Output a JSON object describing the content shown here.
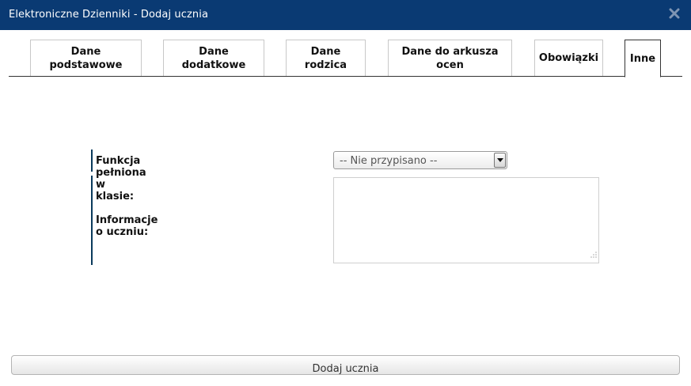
{
  "window": {
    "title": "Elektroniczne Dzienniki - Dodaj ucznia",
    "close_icon": "close-icon"
  },
  "tabs": [
    {
      "label": "Dane\npodstawowe",
      "active": false
    },
    {
      "label": "Dane\ndodatkowe",
      "active": false
    },
    {
      "label": "Dane\nrodzica",
      "active": false
    },
    {
      "label": "Dane do arkusza\nocen",
      "active": false
    },
    {
      "label": "Obowiązki",
      "active": false
    },
    {
      "label": "Inne",
      "active": true
    }
  ],
  "form": {
    "function_label": "Funkcja pełniona w klasie:",
    "function_value": "-- Nie przypisano --",
    "info_label": "Informacje o uczniu:",
    "info_value": ""
  },
  "actions": {
    "submit_label": "Dodaj ucznia"
  },
  "colors": {
    "titlebar": "#0a3a73",
    "field_bar": "#0a3a5c"
  }
}
